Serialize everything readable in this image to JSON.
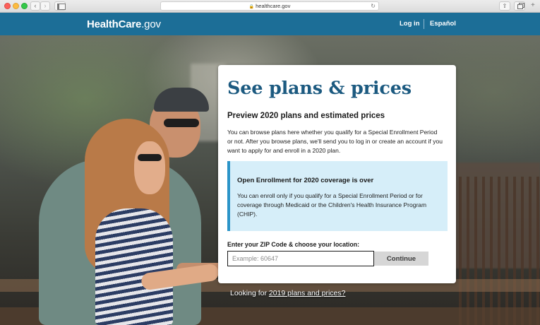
{
  "browser": {
    "url": "healthcare.gov",
    "icons": [
      "close-dot",
      "minimize-dot",
      "zoom-dot",
      "back-arrow-icon",
      "forward-arrow-icon",
      "sidebar-icon",
      "lock-icon",
      "reload-icon",
      "share-icon",
      "tabs-icon",
      "new-tab-plus-icon"
    ]
  },
  "header": {
    "logo_bold": "HealthCare",
    "logo_light": ".gov",
    "login_label": "Log in",
    "spanish_label": "Español",
    "background_color": "#1c6e97"
  },
  "card": {
    "title": "See plans & prices",
    "subtitle": "Preview 2020 plans and estimated prices",
    "description": "You can browse plans here whether you qualify for a Special Enrollment Period or not. After you browse plans, we'll send you to log in or create an account if you want to apply for and enroll in a 2020 plan.",
    "alert": {
      "title": "Open Enrollment for 2020 coverage is over",
      "body": "You can enroll only if you qualify for a Special Enrollment Period or for coverage through Medicaid or the Children's Health Insurance Program (CHIP).",
      "background_color": "#d6eef9",
      "accent_color": "#2b94c8"
    },
    "zip_label": "Enter your ZIP Code & choose your location:",
    "zip_value": "",
    "zip_placeholder": "Example: 60647",
    "continue_label": "Continue",
    "title_color": "#1c5a80"
  },
  "footer_link": {
    "prefix": "Looking for ",
    "link_text": "2019 plans and prices?"
  }
}
